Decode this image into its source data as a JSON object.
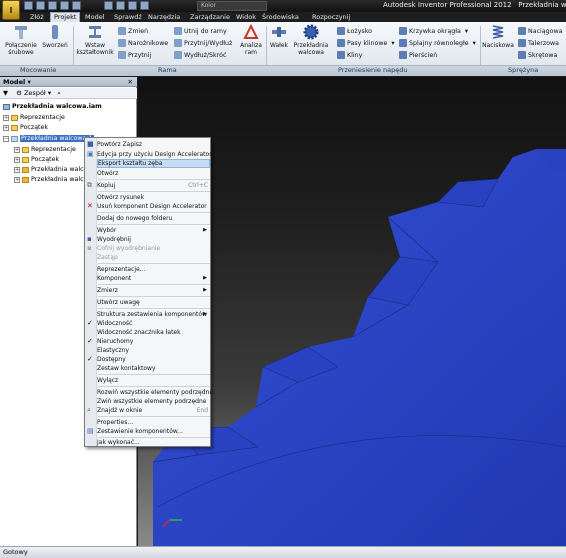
{
  "app": {
    "title": "Autodesk Inventor Professional 2012",
    "document": "Przekładnia walcowa",
    "color_field": "Kolor"
  },
  "tabs": [
    "Złóż",
    "Projekt",
    "Model",
    "Sprawdź",
    "Narzędzia",
    "Zarządzanie",
    "Widok",
    "Środowiska",
    "Rozpoczynij"
  ],
  "active_tab": "Projekt",
  "ribbon": {
    "polaczenie": "Połączenie śrubowe",
    "polaczenie_l1": "Połączenie",
    "polaczenie_l2": "śrubowe",
    "sworzen": "Sworzeń",
    "wstaw": "Wstaw kształtownik",
    "wstaw_l1": "Wstaw",
    "wstaw_l2": "kształtownik",
    "zmien": "Zmień",
    "narozNikowe": "Narożnikowe",
    "przytnij": "Przytnij",
    "utnij": "Utnij do ramy",
    "przytnij_wydluz": "Przytnij/Wydłuż",
    "wydluz_skroc": "Wydłuż/Skróć",
    "analiza": "Analiza ram",
    "analiza_l1": "Analiza",
    "analiza_l2": "ram",
    "walek": "Wałek",
    "przekladnia": "Przekładnia walcowa",
    "przekladnia_l1": "Przekładnia",
    "przekladnia_l2": "walcowa",
    "lozysko": "Łożysko",
    "pasy": "Pasy klinowe",
    "kliny": "Kliny",
    "krzywka": "Krzywka okrągła",
    "splajny": "Splajny równoległe",
    "pierscien": "Pierścień",
    "naciskowa": "Naciskowa",
    "naciagowa": "Naciągowa",
    "talerzowa": "Talerzowa",
    "skretowa": "Skrętowa",
    "panel_mocowanie": "Mocowanie",
    "panel_rama": "Rama",
    "panel_napedu": "Przeniesienie napędu",
    "panel_sprezyny": "Sprężyna"
  },
  "browser": {
    "title": "Model",
    "toolbar_label": "Zespół",
    "root": "Przekładnia walcowa.iam",
    "items": [
      "Reprezentacje",
      "Początek",
      "Przekładnia walcowa:1"
    ],
    "subitems": [
      "Reprezentacje",
      "Początek",
      "Przekładnia walco",
      "Przekładnia walco"
    ]
  },
  "context_menu": {
    "items": [
      {
        "label": "Powtórz Zapisz"
      },
      {
        "label": "Edycja przy użyciu Design Accelerator"
      },
      {
        "label": "Eksport kształtu zęba",
        "highlighted": true
      },
      {
        "label": "Otwórz"
      },
      {
        "label": "Kopiuj",
        "shortcut": "Ctrl+C"
      },
      {
        "label": "Otwórz rysunek"
      },
      {
        "label": "Usuń komponent Design Accelerator"
      },
      {
        "label": "Dodaj do nowego folderu"
      },
      {
        "label": "Wybór",
        "submenu": true
      },
      {
        "label": "Wyodrębnij"
      },
      {
        "label": "Cofnij wyodrębnianie",
        "disabled": true
      },
      {
        "label": "Zastąp",
        "disabled": true
      },
      {
        "label": "Reprezentacje..."
      },
      {
        "label": "Komponent",
        "submenu": true
      },
      {
        "label": "Zmierz",
        "submenu": true
      },
      {
        "label": "Utwórz uwagę"
      },
      {
        "label": "Struktura zestawienia komponentów",
        "submenu": true
      },
      {
        "label": "Widoczność",
        "checked": true
      },
      {
        "label": "Widoczność znacznika łatek"
      },
      {
        "label": "Nieruchomy",
        "checked": true
      },
      {
        "label": "Elastyczny"
      },
      {
        "label": "Dostępny",
        "checked": true
      },
      {
        "label": "Zestaw kontaktowy"
      },
      {
        "label": "Wyłącz"
      },
      {
        "label": "Rozwiń wszystkie elementy podrzędne"
      },
      {
        "label": "Zwiń wszystkie elementy podrzędne"
      },
      {
        "label": "Znajdź w oknie",
        "shortcut": "End"
      },
      {
        "label": "Properties..."
      },
      {
        "label": "Zestawienie komponentów..."
      },
      {
        "label": "Jak wykonać..."
      }
    ]
  },
  "status": "Gotowy",
  "colors": {
    "gear": "#2c44c7",
    "accent": "#c7dcf3"
  }
}
